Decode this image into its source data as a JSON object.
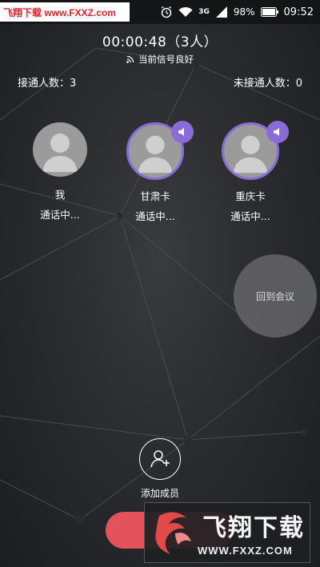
{
  "status_bar": {
    "watermark_text": "飞翔下载 www.FXXZ.com",
    "network_label": "3G",
    "battery": "98%",
    "time": "09:52"
  },
  "call": {
    "timer": "00:00:48（3人）",
    "signal_text": "当前信号良好",
    "connected_count_label": "接通人数：3",
    "unconnected_count_label": "未接通人数：0"
  },
  "members": [
    {
      "name": "我",
      "status": "通话中...",
      "speaking": false
    },
    {
      "name": "甘肃卡",
      "status": "通话中...",
      "speaking": true
    },
    {
      "name": "重庆卡",
      "status": "通话中...",
      "speaking": true
    }
  ],
  "actions": {
    "back_to_meeting": "回到会议",
    "add_member": "添加成员"
  },
  "watermark": {
    "title": "飞翔下载",
    "url": "WWW.FXXZ.COM"
  },
  "colors": {
    "accent_purple": "#8b6bd6",
    "hangup_red": "#e4535c"
  }
}
